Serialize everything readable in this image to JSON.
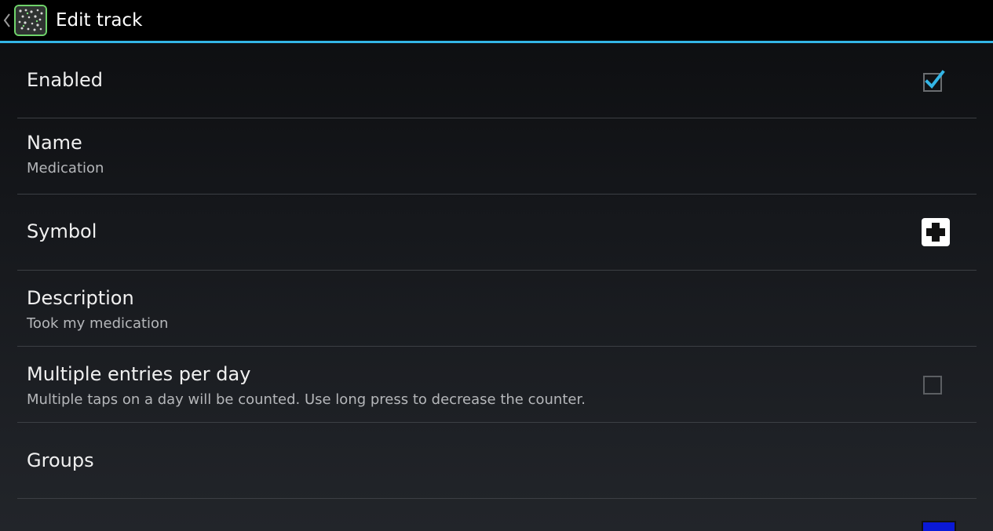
{
  "action_bar": {
    "title": "Edit track",
    "accent_color": "#33b5e5"
  },
  "settings": [
    {
      "key": "enabled",
      "label": "Enabled",
      "widget": "checkbox",
      "checked": true
    },
    {
      "key": "name",
      "label": "Name",
      "summary": "Medication"
    },
    {
      "key": "symbol",
      "label": "Symbol",
      "widget": "symbol",
      "symbol_icon": "medical-cross-icon"
    },
    {
      "key": "description",
      "label": "Description",
      "summary": "Took my medication"
    },
    {
      "key": "multiple",
      "label": "Multiple entries per day",
      "summary": "Multiple taps on a day will be counted. Use long press to decrease the counter.",
      "widget": "checkbox",
      "checked": false
    },
    {
      "key": "groups",
      "label": "Groups"
    }
  ],
  "next_row": {
    "color_swatch": "#0a19d6"
  }
}
